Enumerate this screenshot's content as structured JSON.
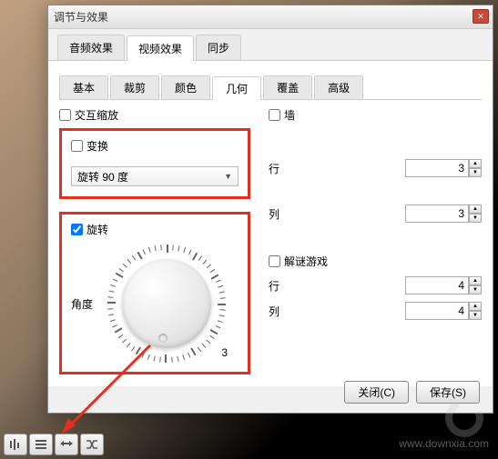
{
  "window": {
    "title": "调节与效果"
  },
  "main_tabs": [
    "音频效果",
    "视频效果",
    "同步"
  ],
  "sub_tabs": [
    "基本",
    "裁剪",
    "颜色",
    "几何",
    "覆盖",
    "高级"
  ],
  "geometry": {
    "interactive_zoom_label": "交互缩放",
    "transform_label": "变换",
    "transform_select": "旋转 90 度",
    "rotate_label": "旋转",
    "angle_label": "角度",
    "dial_value": "3",
    "wall_label": "墙",
    "rows_label": "行",
    "cols_label": "列",
    "wall_rows": "3",
    "wall_cols": "3",
    "puzzle_label": "解谜游戏",
    "puzzle_rows": "4",
    "puzzle_cols": "4"
  },
  "footer": {
    "close": "关闭(C)",
    "save": "保存(S)"
  },
  "toolbar_icons": [
    "equalizer-icon",
    "list-icon",
    "loop-icon",
    "shuffle-icon"
  ],
  "watermark": {
    "url": "www.downxia.com"
  }
}
